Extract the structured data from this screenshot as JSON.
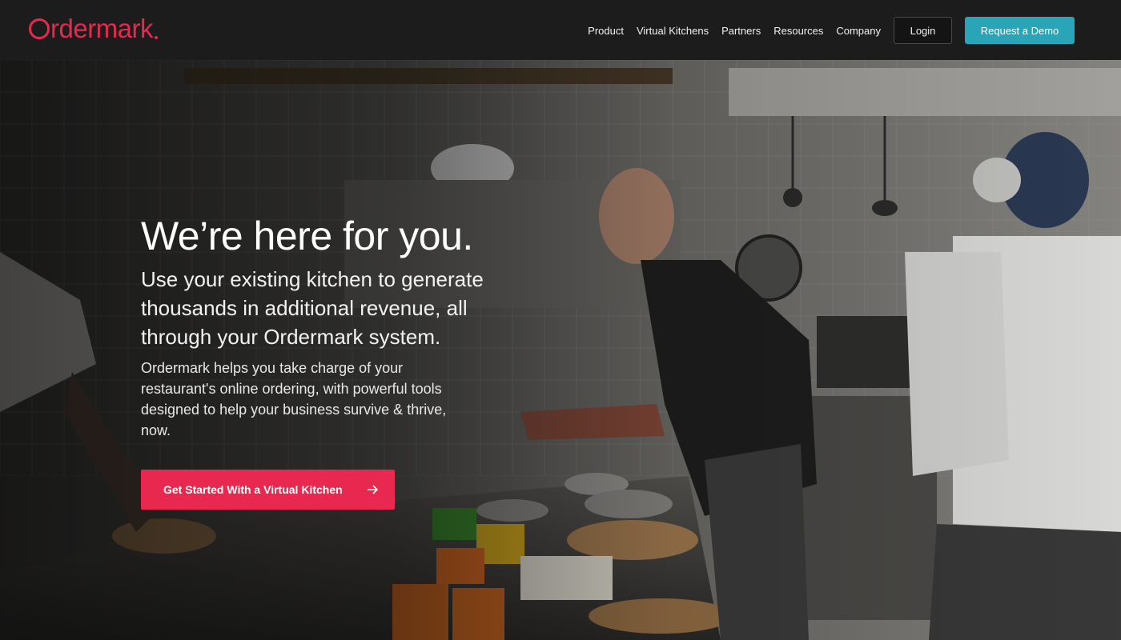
{
  "brand": {
    "name": "Ordermark",
    "logo_text": "rdermark",
    "accent_color": "#e8284f",
    "demo_color": "#2aa5b8"
  },
  "nav": {
    "items": [
      {
        "label": "Product"
      },
      {
        "label": "Virtual Kitchens"
      },
      {
        "label": "Partners"
      },
      {
        "label": "Resources"
      },
      {
        "label": "Company"
      }
    ],
    "login_label": "Login",
    "demo_label": "Request a Demo"
  },
  "hero": {
    "title": "We’re here for you.",
    "subtitle": "Use your existing kitchen to generate thousands in additional revenue, all through your Ordermark system.",
    "description": "Ordermark helps you take charge of your restaurant's online ordering, with powerful tools designed to help your business survive & thrive, now.",
    "cta_label": "Get Started With a Virtual Kitchen",
    "cta_icon": "arrow-right-icon",
    "background": "kitchen-chefs-photo"
  }
}
